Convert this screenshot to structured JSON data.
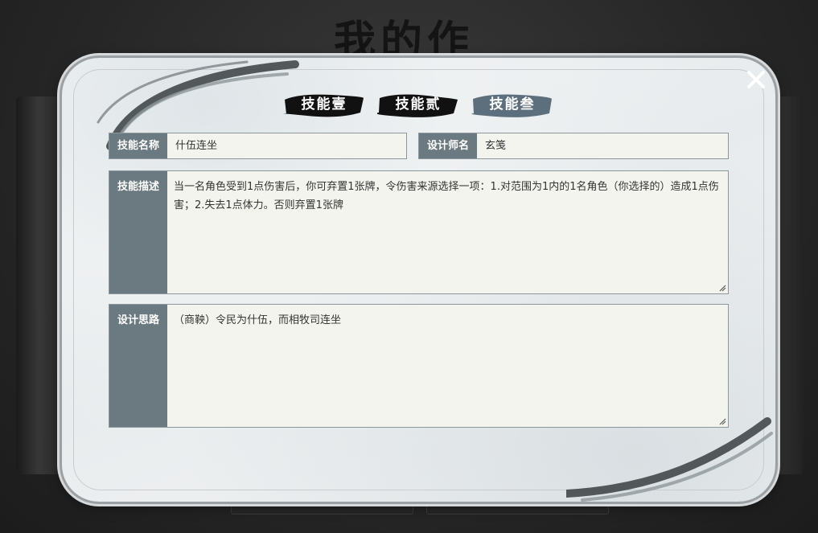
{
  "background": {
    "title": "我的作品"
  },
  "dialog": {
    "close_icon": "close-icon",
    "tabs": [
      {
        "label": "技能壹",
        "active": false
      },
      {
        "label": "技能贰",
        "active": false
      },
      {
        "label": "技能叁",
        "active": true
      }
    ],
    "skill_name": {
      "label": "技能名称",
      "value": "什伍连坐"
    },
    "designer": {
      "label": "设计师名",
      "value": "玄笺"
    },
    "skill_desc": {
      "label": "技能描述",
      "value": "当一名角色受到1点伤害后，你可弃置1张牌，令伤害来源选择一项：1.对范围为1内的1名角色（你选择的）造成1点伤害；2.失去1点体力。否则弃置1张牌"
    },
    "design_idea": {
      "label": "设计思路",
      "value": "（商鞅）令民为什伍，而相牧司连坐"
    }
  },
  "colors": {
    "label_bg": "#6b7a80",
    "field_bg": "#f4f4ef",
    "tab_inactive": "#111111",
    "tab_active": "#5d6f7d"
  }
}
